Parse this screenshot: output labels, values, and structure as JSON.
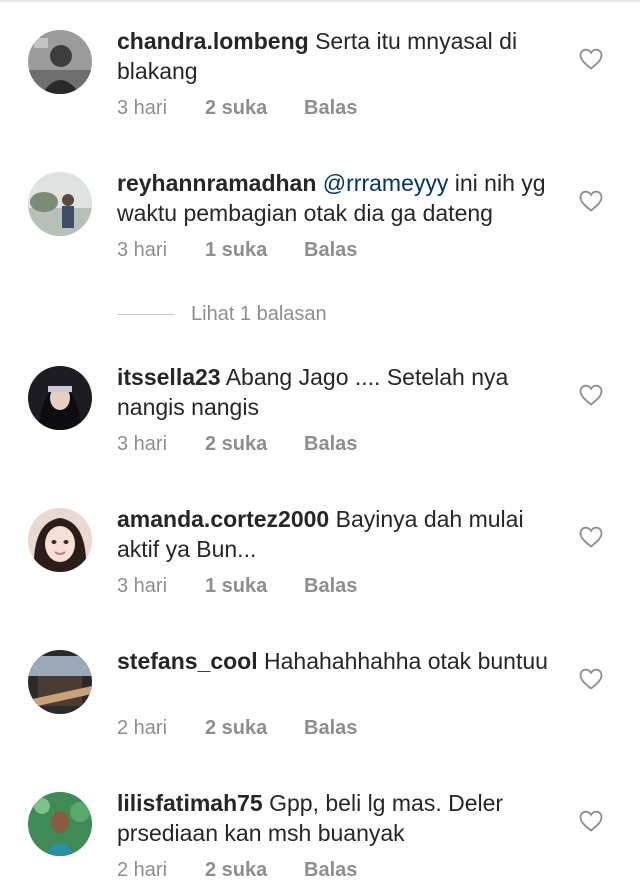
{
  "comments": [
    {
      "username": "chandra.lombeng",
      "mention": "",
      "text": "Serta itu mnyasal di blakang",
      "time": "3 hari",
      "likes": "2 suka",
      "reply": "Balas"
    },
    {
      "username": "reyhannramadhan",
      "mention": "@rrrameyyy",
      "text": "ini nih yg waktu pembagian otak dia ga dateng",
      "time": "3 hari",
      "likes": "1 suka",
      "reply": "Balas"
    },
    {
      "username": "itssella23",
      "mention": "",
      "text": "Abang Jago .... Setelah nya nangis nangis",
      "time": "3 hari",
      "likes": "2 suka",
      "reply": "Balas"
    },
    {
      "username": "amanda.cortez2000",
      "mention": "",
      "text": "Bayinya dah mulai aktif ya Bun...",
      "time": "3 hari",
      "likes": "1 suka",
      "reply": "Balas"
    },
    {
      "username": "stefans_cool",
      "mention": "",
      "text": "Hahahahhahha otak buntuu",
      "time": "2 hari",
      "likes": "2 suka",
      "reply": "Balas"
    },
    {
      "username": "lilisfatimah75",
      "mention": "",
      "text": "Gpp,  beli lg mas. Deler prsediaan kan msh buanyak",
      "time": "2 hari",
      "likes": "2 suka",
      "reply": "Balas"
    }
  ],
  "view_replies": "Lihat 1 balasan",
  "icons": {
    "like": "heart-outline-icon"
  },
  "colors": {
    "text": "#262626",
    "muted": "#8e8e8e",
    "mention": "#003569"
  }
}
